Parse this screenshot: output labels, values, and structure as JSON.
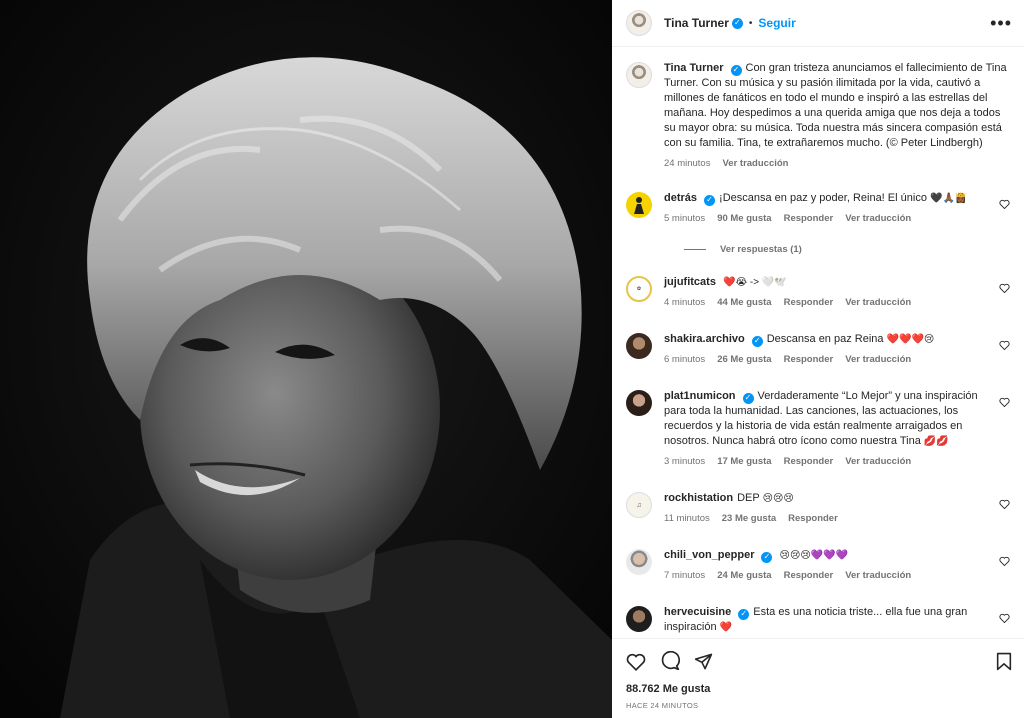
{
  "header": {
    "username": "Tina Turner",
    "follow_label": "Seguir"
  },
  "caption": {
    "username": "Tina Turner",
    "text": "Con gran tristeza anunciamos el fallecimiento de Tina Turner. Con su música y su pasión ilimitada por la vida, cautivó a millones de fanáticos en todo el mundo e inspiró a las estrellas del mañana. Hoy despedimos a una querida amiga que nos deja a todos su mayor obra: su música. Toda nuestra más sincera compasión está con su familia. Tina, te extrañaremos mucho. (© Peter Lindbergh)",
    "time": "24 minutos",
    "translate": "Ver traducción"
  },
  "comments": [
    {
      "username": "detrás",
      "text": "¡Descansa en paz y poder, Reina! El único",
      "emoji": "🖤🙏🏾👸🏾",
      "time": "5 minutos",
      "likes": "90 Me gusta",
      "reply": "Responder",
      "translate": "Ver traducción",
      "verified": true
    },
    {
      "username": "jujufitcats",
      "text": "",
      "emoji": "❤️😭 -> 🤍🕊️",
      "time": "4 minutos",
      "likes": "44 Me gusta",
      "reply": "Responder",
      "translate": "Ver traducción",
      "verified": false
    },
    {
      "username": "shakira.archivo",
      "text": "Descansa en paz Reina",
      "emoji": "❤️❤️❤️😢",
      "time": "6 minutos",
      "likes": "26 Me gusta",
      "reply": "Responder",
      "translate": "Ver traducción",
      "verified": true
    },
    {
      "username": "plat1numicon",
      "text": "Verdaderamente “Lo Mejor” y una inspiración para toda la humanidad. Las canciones, las actuaciones, los recuerdos y la historia de vida están realmente arraigados en nosotros. Nunca habrá otro ícono como nuestra Tina",
      "emoji": "💋💋",
      "time": "3 minutos",
      "likes": "17 Me gusta",
      "reply": "Responder",
      "translate": "Ver traducción",
      "verified": true
    },
    {
      "username": "rockhistation",
      "text": "DEP",
      "emoji": "😢😢😢",
      "time": "11 minutos",
      "likes": "23 Me gusta",
      "reply": "Responder",
      "translate": "",
      "verified": false
    },
    {
      "username": "chili_von_pepper",
      "text": "",
      "emoji": "😢😢😢💜💜💜",
      "time": "7 minutos",
      "likes": "24 Me gusta",
      "reply": "Responder",
      "translate": "Ver traducción",
      "verified": true
    },
    {
      "username": "hervecuisine",
      "text": "Esta es una noticia triste... ella fue una gran inspiración",
      "emoji": "❤️",
      "time": "",
      "likes": "",
      "reply": "",
      "translate": "",
      "verified": true
    }
  ],
  "view_replies": "Ver respuestas (1)",
  "footer": {
    "likes": "88.762 Me gusta",
    "ago": "HACE 24 MINUTOS"
  },
  "colors": {
    "accent": "#0095f6",
    "text": "#262626",
    "muted": "#737373"
  }
}
